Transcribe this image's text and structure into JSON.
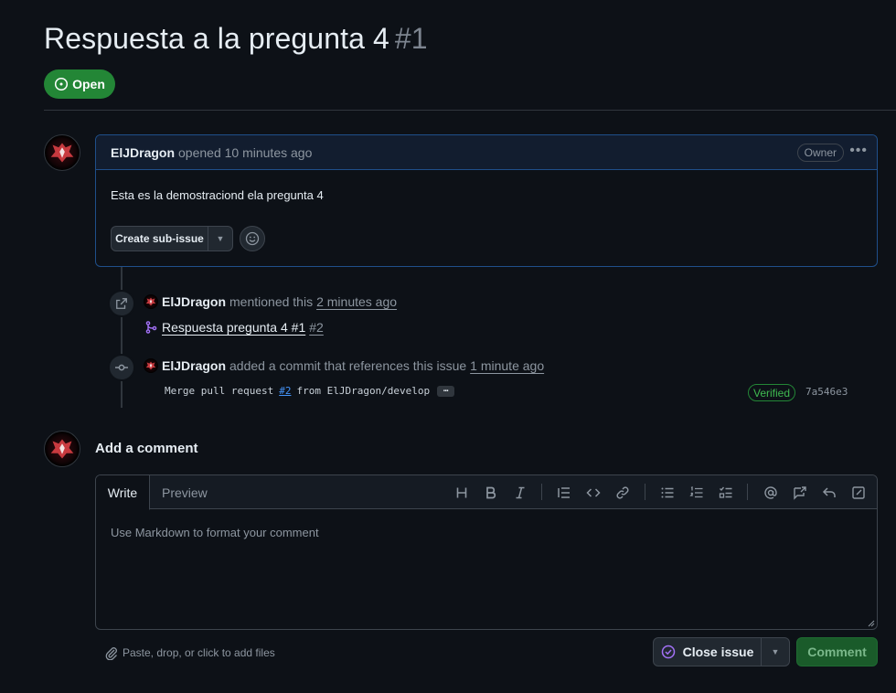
{
  "issue": {
    "title": "Respuesta a la pregunta 4",
    "number": "#1",
    "state": "Open"
  },
  "comment": {
    "author": "ElJDragon",
    "meta": "opened 10 minutes ago",
    "role_badge": "Owner",
    "body": "Esta es la demostraciond ela pregunta 4",
    "create_sub_issue_label": "Create sub-issue"
  },
  "timeline": {
    "mention": {
      "author": "ElJDragon",
      "action": "mentioned this",
      "time": "2 minutes ago",
      "ref_title": "Respuesta pregunta 4 #1",
      "ref_number": "#2"
    },
    "commit": {
      "author": "ElJDragon",
      "action": "added a commit that references this issue",
      "time": "1 minute ago",
      "message_prefix": "Merge pull request",
      "pr_link": "#2",
      "message_suffix": "from ElJDragon/develop",
      "ellipsis": "…",
      "verified": "Verified",
      "sha": "7a546e3"
    }
  },
  "add_comment": {
    "heading": "Add a comment",
    "tab_write": "Write",
    "tab_preview": "Preview",
    "placeholder": "Use Markdown to format your comment",
    "attach_text": "Paste, drop, or click to add files",
    "close_issue_label": "Close issue",
    "comment_label": "Comment"
  },
  "colors": {
    "background": "#0d1117",
    "open_green": "#238636",
    "link_blue": "#4493f8",
    "purple": "#a371f7"
  }
}
